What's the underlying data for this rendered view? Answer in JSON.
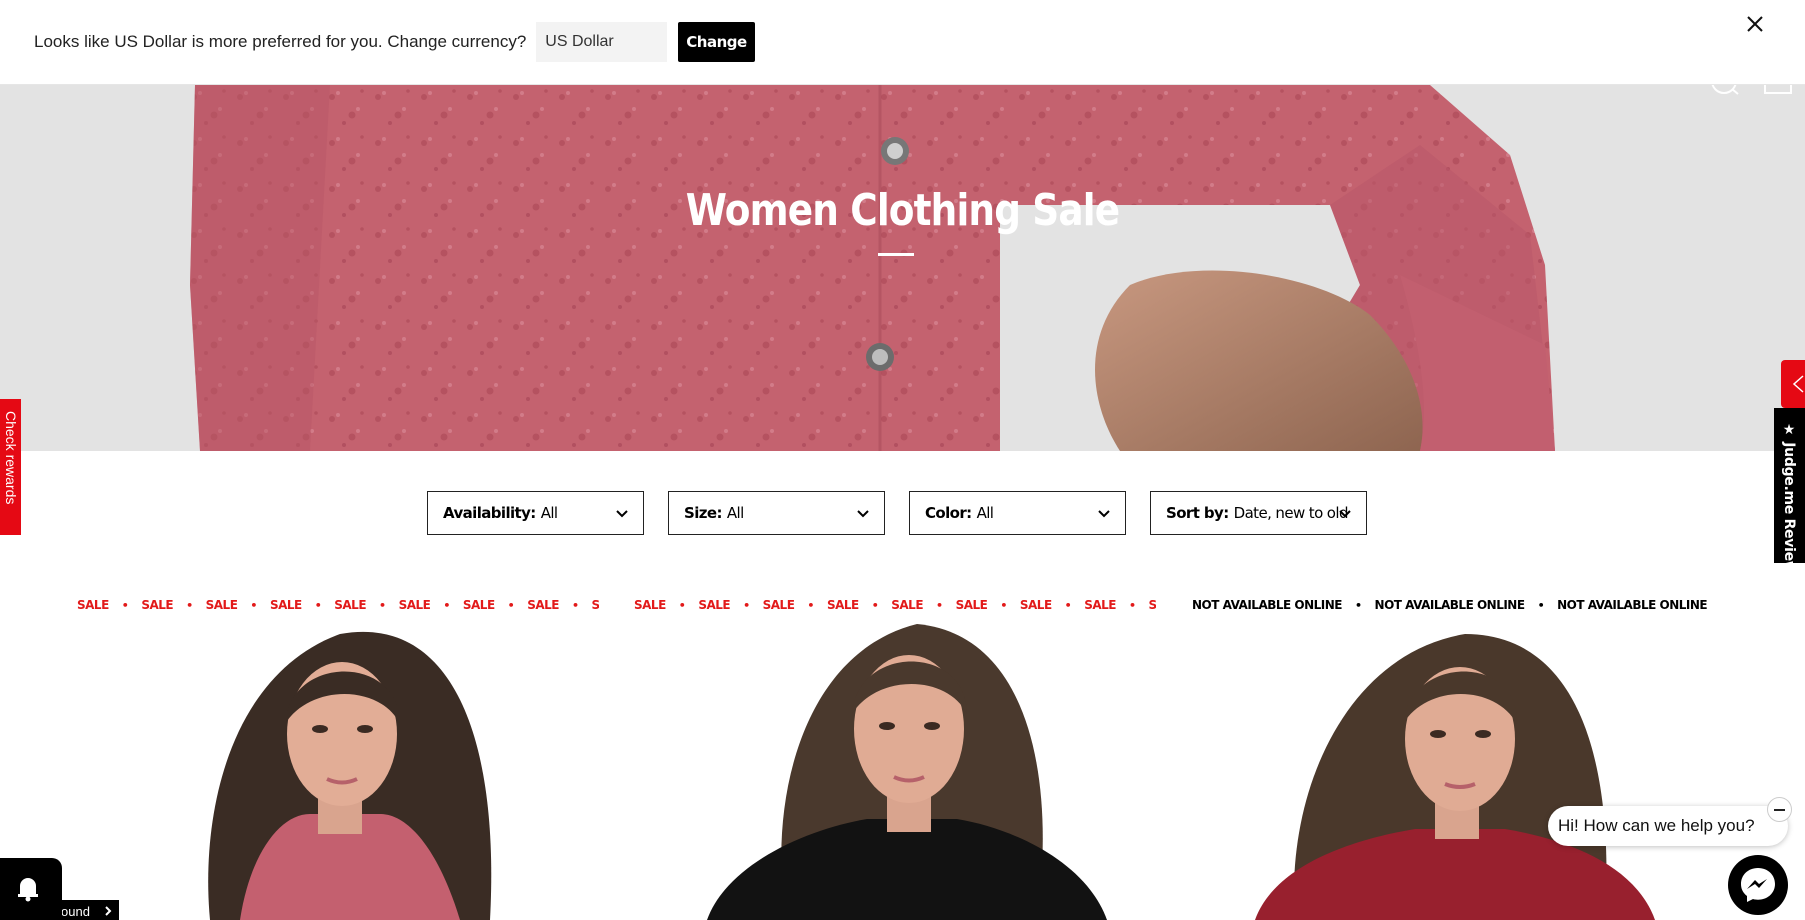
{
  "currency_bar": {
    "message": "Looks like US Dollar is more preferred for you. Change currency?",
    "selected_currency": "US Dollar",
    "change_label": "Change"
  },
  "hero": {
    "title": "Women Clothing Sale"
  },
  "filters": [
    {
      "label": "Availability:",
      "value": "All"
    },
    {
      "label": "Size:",
      "value": "All"
    },
    {
      "label": "Color:",
      "value": "All"
    },
    {
      "label": "Sort by:",
      "value": "Date, new to old"
    }
  ],
  "products": [
    {
      "badge": "SALE",
      "badge_color": "#e21a1a",
      "shirt_color": "#c8687a"
    },
    {
      "badge": "SALE",
      "badge_color": "#e21a1a",
      "shirt_color": "#111111"
    },
    {
      "badge": "NOT AVAILABLE ONLINE",
      "badge_color": "#000000",
      "shirt_color": "#9b1c2a"
    }
  ],
  "side_tabs": {
    "rewards": "Check rewards",
    "reviews": "★ Judge.me Reviews"
  },
  "widgets": {
    "around_chip": "ound",
    "chat_prompt": "Hi! How can we help you?"
  },
  "icons": [
    "close-icon",
    "search-icon",
    "cart-icon",
    "chevron-down-icon",
    "bell-icon",
    "messenger-icon",
    "chevron-right-icon"
  ],
  "colors": {
    "accent_red": "#e50914",
    "sale_red": "#e21a1a",
    "button_black": "#000000"
  }
}
